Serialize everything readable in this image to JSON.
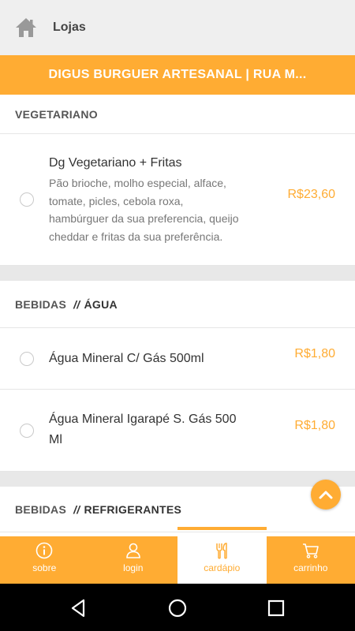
{
  "topbar": {
    "title": "Lojas",
    "home_icon": "home-icon"
  },
  "store": {
    "name": "DIGUS BURGUER ARTESANAL | RUA M..."
  },
  "sections": {
    "vegetariano": {
      "label": "VEGETARIANO"
    },
    "bebidas_agua": {
      "label": "BEBIDAS",
      "sep": "//",
      "sub": "ÁGUA"
    },
    "bebidas_refri": {
      "label": "BEBIDAS",
      "sep": "//",
      "sub": "REFRIGERANTES"
    }
  },
  "items": [
    {
      "name": "Dg Vegetariano + Fritas",
      "desc_lines": [
        "Pão brioche, molho especial, alface,",
        "tomate, picles, cebola roxa,",
        "hambúrguer da sua preferencia, queijo",
        "cheddar e fritas da sua preferência."
      ],
      "price": "R$23,60"
    },
    {
      "name": "Água Mineral C/ Gás 500ml",
      "price": "R$1,80"
    },
    {
      "name_lines": [
        "Água Mineral Igarapé S. Gás 500",
        "Ml"
      ],
      "price": "R$1,80"
    }
  ],
  "bottom_nav": [
    {
      "label": "sobre",
      "icon": "info-icon"
    },
    {
      "label": "login",
      "icon": "user-icon"
    },
    {
      "label": "cardápio",
      "icon": "cutlery-icon",
      "active": true
    },
    {
      "label": "carrinho",
      "icon": "cart-icon"
    }
  ],
  "colors": {
    "accent": "#ffac33",
    "topbar_bg": "#efefef",
    "divider": "#e8e8e8"
  }
}
